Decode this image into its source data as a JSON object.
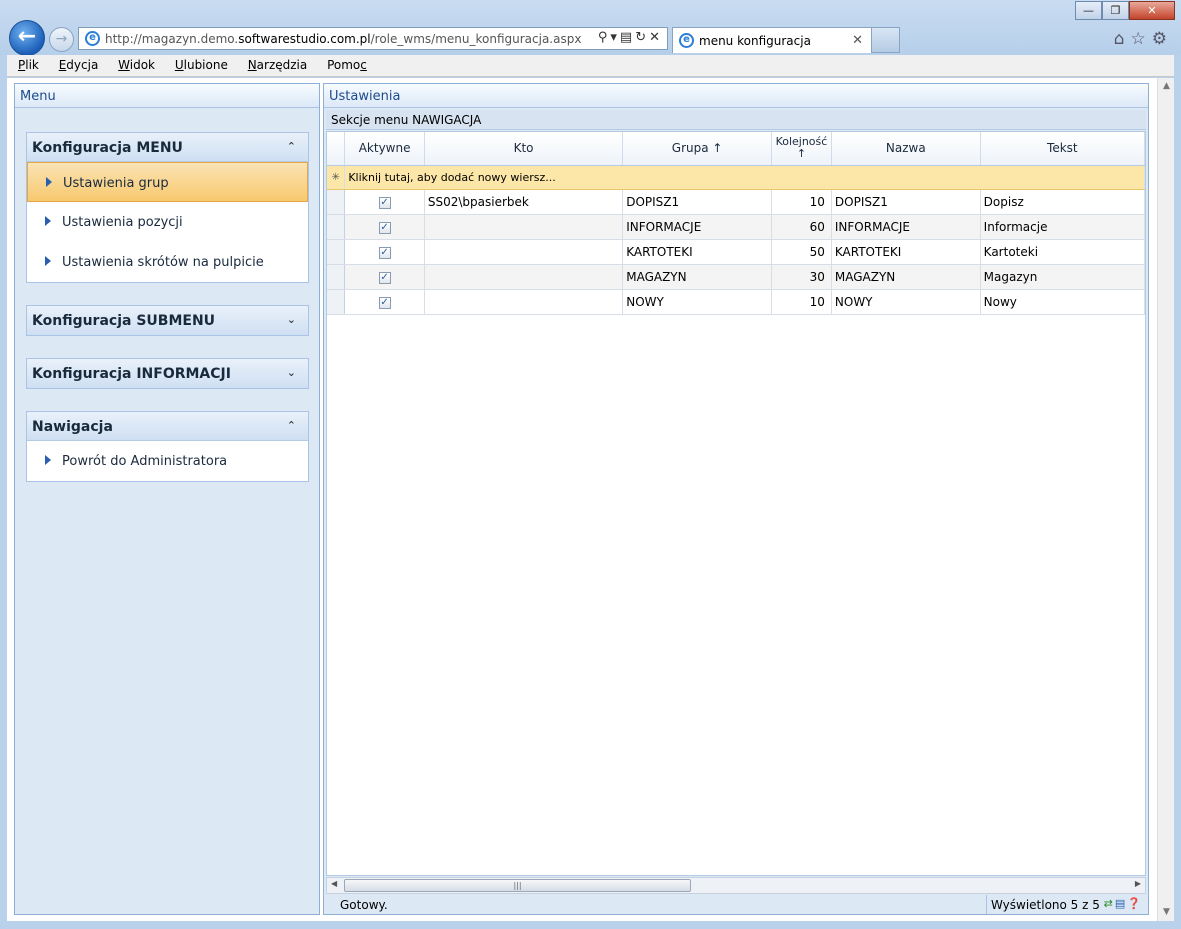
{
  "browser": {
    "url_prefix": "http://magazyn.demo.",
    "url_domain": "softwarestudio.com.pl",
    "url_path": "/role_wms/menu_konfiguracja.aspx",
    "tab_title": "menu konfiguracja",
    "menu": [
      {
        "label": "Plik",
        "key": "P",
        "rest": "lik"
      },
      {
        "label": "Edycja",
        "key": "E",
        "rest": "dycja"
      },
      {
        "label": "Widok",
        "key": "W",
        "rest": "idok"
      },
      {
        "label": "Ulubione",
        "key": "U",
        "rest": "lubione"
      },
      {
        "label": "Narzędzia",
        "key": "N",
        "rest": "arzędzia"
      },
      {
        "label": "Pomoc",
        "key": "Pomo",
        "rest": "c"
      }
    ]
  },
  "left_pane": {
    "header": "Menu",
    "groups": [
      {
        "title": "Konfiguracja MENU",
        "expanded": true,
        "items": [
          "Ustawienia grup",
          "Ustawienia pozycji",
          "Ustawienia skrótów na pulpicie"
        ]
      },
      {
        "title": "Konfiguracja SUBMENU",
        "expanded": false,
        "items": []
      },
      {
        "title": "Konfiguracja INFORMACJI",
        "expanded": false,
        "items": []
      },
      {
        "title": "Nawigacja",
        "expanded": true,
        "items": [
          "Powrót do Administratora"
        ]
      }
    ]
  },
  "right_pane": {
    "header": "Ustawienia",
    "grid_caption": "Sekcje menu NAWIGACJA",
    "columns": [
      "Aktywne",
      "Kto",
      "Grupa ↑",
      "Kolejność ↑",
      "Nazwa",
      "Tekst"
    ],
    "new_row_text": "Kliknij tutaj, aby dodać nowy wiersz...",
    "rows": [
      {
        "aktywne": true,
        "kto": "SS02\\bpasierbek",
        "grupa": "DOPISZ1",
        "kolejnosc": "10",
        "nazwa": "DOPISZ1",
        "tekst": "Dopisz"
      },
      {
        "aktywne": true,
        "kto": "",
        "grupa": "INFORMACJE",
        "kolejnosc": "60",
        "nazwa": "INFORMACJE",
        "tekst": "Informacje"
      },
      {
        "aktywne": true,
        "kto": "",
        "grupa": "KARTOTEKI",
        "kolejnosc": "50",
        "nazwa": "KARTOTEKI",
        "tekst": "Kartoteki"
      },
      {
        "aktywne": true,
        "kto": "",
        "grupa": "MAGAZYN",
        "kolejnosc": "30",
        "nazwa": "MAGAZYN",
        "tekst": "Magazyn"
      },
      {
        "aktywne": true,
        "kto": "",
        "grupa": "NOWY",
        "kolejnosc": "10",
        "nazwa": "NOWY",
        "tekst": "Nowy"
      }
    ],
    "status": "Gotowy.",
    "record_info": "Wyświetlono 5 z 5"
  }
}
